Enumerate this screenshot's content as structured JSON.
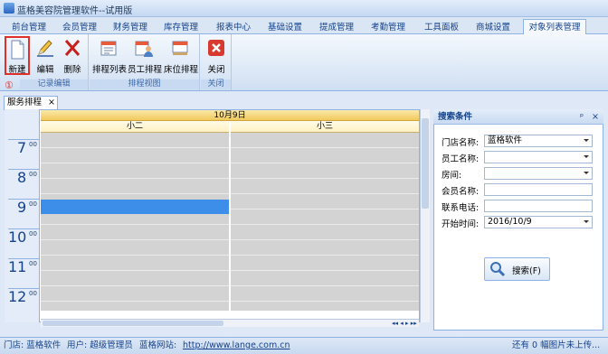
{
  "window": {
    "title": "蓝格美容院管理软件--试用版"
  },
  "menu_tabs": [
    "前台管理",
    "会员管理",
    "财务管理",
    "库存管理",
    "报表中心",
    "基础设置",
    "提成管理",
    "考勤管理",
    "工具面板",
    "商城设置",
    "对象列表管理"
  ],
  "ribbon": {
    "groups": [
      {
        "label": "记录编辑",
        "buttons": [
          "新建",
          "编辑",
          "删除"
        ]
      },
      {
        "label": "排程视图",
        "buttons": [
          "排程列表",
          "员工排程",
          "床位排程"
        ]
      },
      {
        "label": "关闭",
        "buttons": [
          "关闭"
        ]
      }
    ],
    "annotation": "①"
  },
  "doc_tab": {
    "label": "服务排程",
    "close": "×"
  },
  "schedule": {
    "date": "10月9日",
    "columns": [
      "小二",
      "小三"
    ],
    "hours": [
      "7",
      "8",
      "9",
      "10",
      "11",
      "12"
    ],
    "minutes": "00"
  },
  "search_panel": {
    "title": "搜索条件",
    "pin": "ᵠ",
    "close": "×",
    "fields": [
      {
        "label": "门店名称:",
        "value": "蓝格软件",
        "dropdown": true
      },
      {
        "label": "员工名称:",
        "value": "",
        "dropdown": true
      },
      {
        "label": "房间:",
        "value": "",
        "dropdown": true
      },
      {
        "label": "会员名称:",
        "value": "",
        "dropdown": false
      },
      {
        "label": "联系电话:",
        "value": "",
        "dropdown": false
      },
      {
        "label": "开始时间:",
        "value": "2016/10/9",
        "dropdown": true
      }
    ],
    "search_button": "搜索(F)"
  },
  "status_bar": {
    "store": "门店: 蓝格软件",
    "user": "用户: 超级管理员",
    "website_label": "蓝格网站:",
    "website": "http://www.lange.com.cn",
    "upload": "还有 0 幅图片未上传..."
  }
}
